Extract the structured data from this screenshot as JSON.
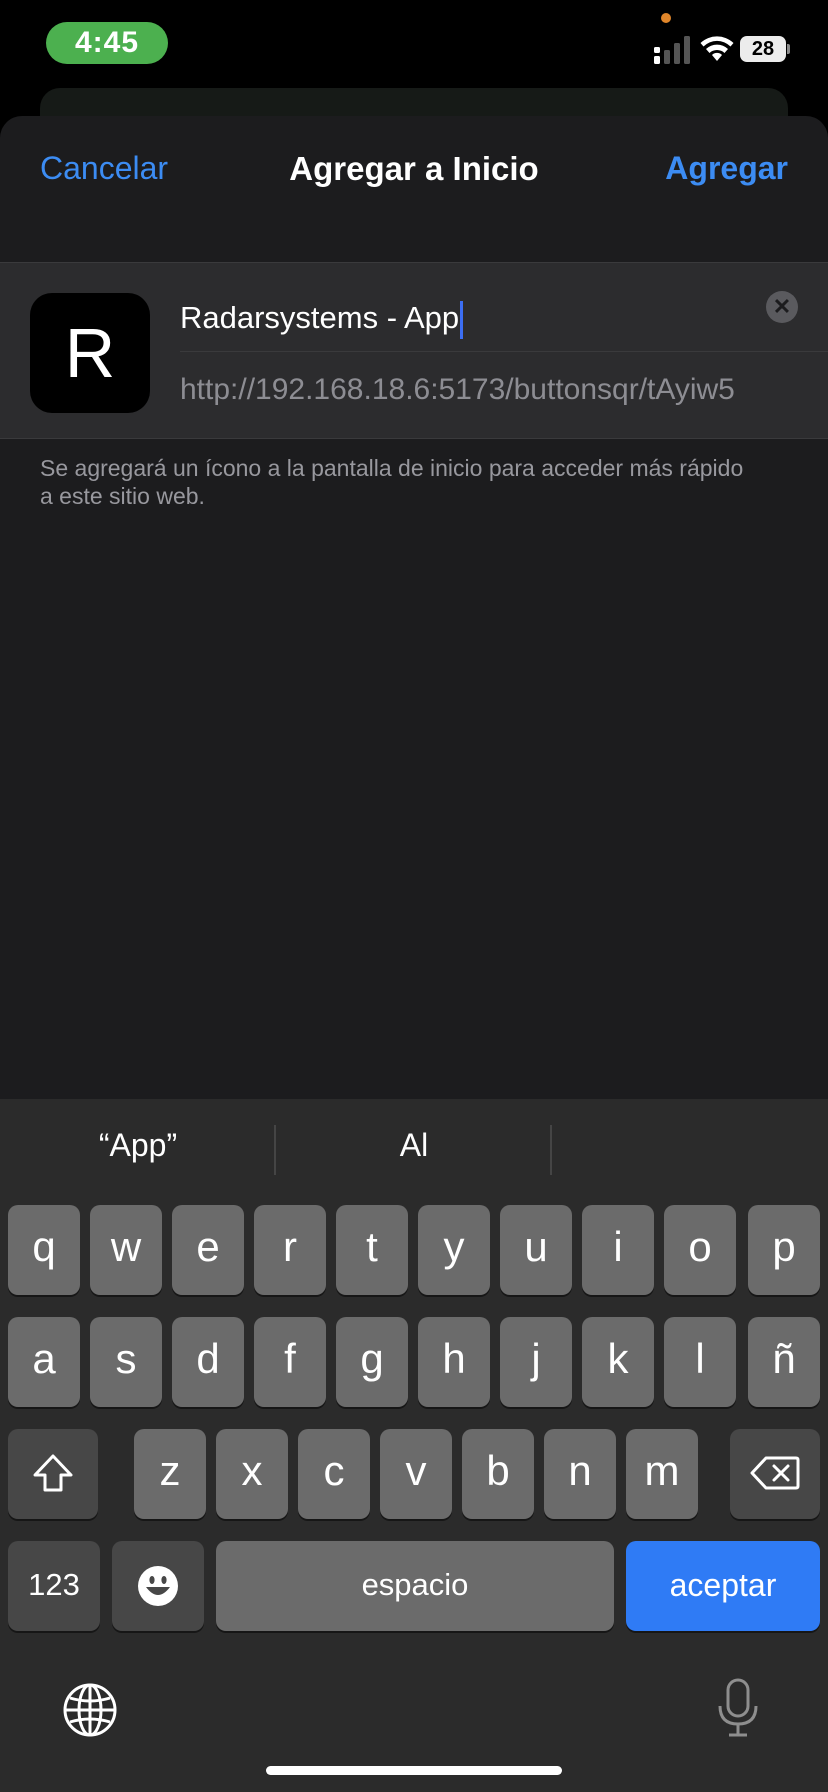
{
  "status_bar": {
    "time": "4:45",
    "battery": "28"
  },
  "nav": {
    "cancel": "Cancelar",
    "title": "Agregar a Inicio",
    "add": "Agregar"
  },
  "form": {
    "icon_letter": "R",
    "name_value": "Radarsystems - App",
    "url": "http://192.168.18.6:5173/buttonsqr/tAyiw5"
  },
  "helper_text": "Se agregará un ícono a la pantalla de inicio para acceder más rápido a este sitio web.",
  "keyboard": {
    "suggestions": [
      "“App”",
      "Al",
      ""
    ],
    "row1": [
      "q",
      "w",
      "e",
      "r",
      "t",
      "y",
      "u",
      "i",
      "o",
      "p"
    ],
    "row2": [
      "a",
      "s",
      "d",
      "f",
      "g",
      "h",
      "j",
      "k",
      "l",
      "ñ"
    ],
    "row3": [
      "z",
      "x",
      "c",
      "v",
      "b",
      "n",
      "m"
    ],
    "numbers_key": "123",
    "space_key": "espacio",
    "return_key": "aceptar"
  },
  "colors": {
    "accent": "#3c8cf3",
    "return_key": "#2f7bf5",
    "time_pill": "#4cb04f"
  }
}
